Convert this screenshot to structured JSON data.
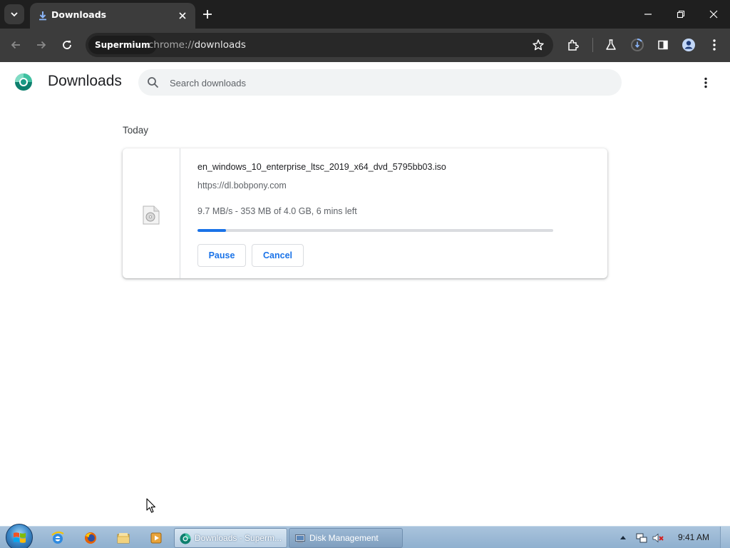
{
  "tabstrip": {
    "tab_title": "Downloads",
    "icons": {
      "tab_search": "chevron-down-icon",
      "tab_favicon": "download-icon",
      "tab_close": "close-icon",
      "new_tab": "plus-icon",
      "minimize": "minimize-icon",
      "restore": "restore-icon",
      "close_window": "close-icon"
    }
  },
  "toolbar": {
    "origin_chip": "Supermium",
    "url_scheme": "chrome://",
    "url_path": "downloads",
    "icons": [
      "back-icon",
      "forward-icon",
      "reload-icon",
      "bookmark-star-icon",
      "extensions-icon",
      "labs-icon",
      "download-indicator-icon",
      "side-panel-icon",
      "profile-icon",
      "menu-icon"
    ]
  },
  "header": {
    "title": "Downloads",
    "search_placeholder": "Search downloads"
  },
  "downloads": {
    "day_label": "Today",
    "item": {
      "file_name": "en_windows_10_enterprise_ltsc_2019_x64_dvd_5795bb03.iso",
      "url": "https://dl.bobpony.com",
      "status": "9.7 MB/s - 353 MB of 4.0 GB, 6 mins left",
      "progress_fraction": 0.08,
      "pause_label": "Pause",
      "cancel_label": "Cancel"
    }
  },
  "taskbar": {
    "tasks": [
      {
        "label": "Downloads - Superm...",
        "active": true
      },
      {
        "label": "Disk Management",
        "active": false
      }
    ],
    "clock": "9:41 AM"
  },
  "colors": {
    "accent": "#1a73e8",
    "tab_strip": "#1f1f1f",
    "toolbar": "#3c3c3c"
  }
}
